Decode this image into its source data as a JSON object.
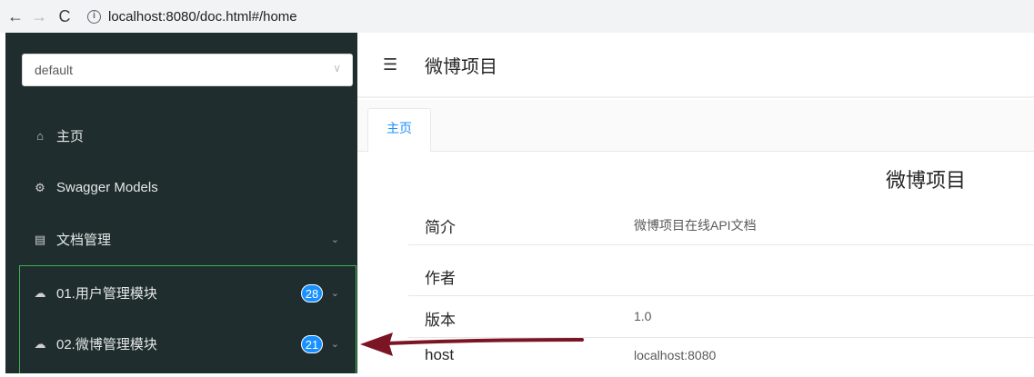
{
  "browser": {
    "back": "←",
    "forward": "→",
    "reload": "C",
    "info": "i",
    "url": "localhost:8080/doc.html#/home"
  },
  "sidebar": {
    "select_value": "default",
    "select_arrow": "∨",
    "items": [
      {
        "icon": "home-icon",
        "glyph": "⌂",
        "label": "主页"
      },
      {
        "icon": "models-icon",
        "glyph": "⚙",
        "label": "Swagger Models"
      },
      {
        "icon": "document-icon",
        "glyph": "▤",
        "label": "文档管理",
        "chevron": "⌄"
      },
      {
        "icon": "cloud-icon",
        "glyph": "☁",
        "label": "01.用户管理模块",
        "badge": "28",
        "chevron": "⌄"
      },
      {
        "icon": "cloud-icon",
        "glyph": "☁",
        "label": "02.微博管理模块",
        "badge": "21",
        "chevron": "⌄"
      }
    ]
  },
  "header": {
    "toggle_glyph": "☰",
    "title": "微博项目"
  },
  "tabs": [
    {
      "label": "主页"
    }
  ],
  "content": {
    "title": "微博项目",
    "rows": [
      {
        "label": "简介",
        "value": "微博项目在线API文档"
      },
      {
        "label": "作者",
        "value": ""
      },
      {
        "label": "版本",
        "value": "1.0"
      },
      {
        "label": "host",
        "value": "localhost:8080"
      }
    ]
  },
  "colors": {
    "sidebar_bg": "#1f2d2f",
    "accent": "#1890ff",
    "highlight_frame": "#3fb24f",
    "annotation_arrow": "#7b1524"
  }
}
